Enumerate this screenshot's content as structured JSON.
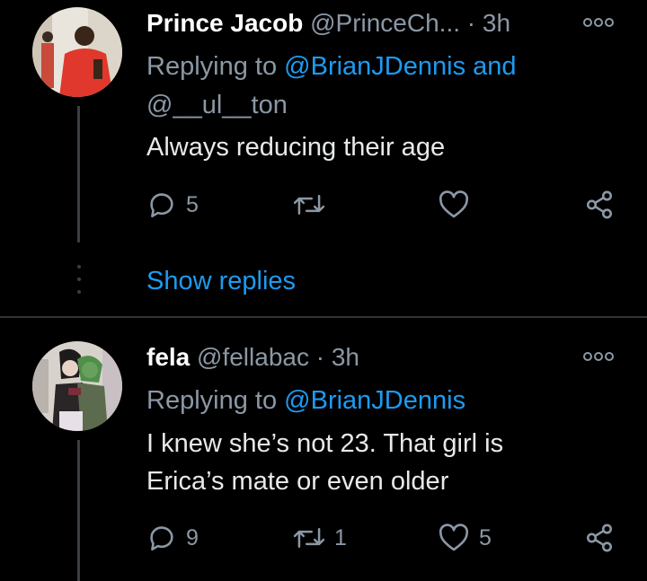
{
  "tweets": [
    {
      "name": "Prince Jacob",
      "handle": "@PrinceCh...",
      "sep": "·",
      "time": "3h",
      "replying_prefix": "Replying to",
      "replying_users": "@BrianJDennis and",
      "replying_users_2": "@__ul__ton",
      "text_lines": [
        "Always reducing their age"
      ],
      "replies": "5",
      "retweets": "",
      "likes": ""
    },
    {
      "name": "fela",
      "handle": "@fellabac",
      "sep": "·",
      "time": "3h",
      "replying_prefix": "Replying to",
      "replying_users": "@BrianJDennis",
      "text_lines": [
        "I knew she’s not 23.  That girl is",
        "Erica’s mate or even older"
      ],
      "replies": "9",
      "retweets": "1",
      "likes": "5"
    }
  ],
  "show_replies_label": "Show replies",
  "colors": {
    "background": "#000000",
    "text": "#e7e9ea",
    "secondary": "#8b98a5",
    "link": "#1d9bf0",
    "divider": "#2f3336"
  },
  "icons": [
    "reply-icon",
    "retweet-icon",
    "like-icon",
    "share-icon",
    "more-icon"
  ]
}
